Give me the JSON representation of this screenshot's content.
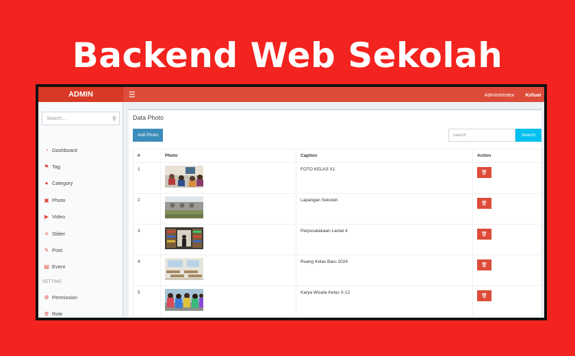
{
  "headline": "Backend Web Sekolah",
  "colors": {
    "background": "#f3231f",
    "header": "#dd4b39",
    "primary": "#3c8dbc",
    "info": "#00c0ef",
    "danger": "#dd4b39"
  },
  "topbar": {
    "brand": "ADMIN",
    "menu_icon": "hamburger-icon",
    "user": "Administrator",
    "logout": "Keluar"
  },
  "sidebar": {
    "search_placeholder": "Search...",
    "items": [
      {
        "label": "Dashboard",
        "icon": "dashboard-icon"
      },
      {
        "label": "Tag",
        "icon": "tag-icon"
      },
      {
        "label": "Category",
        "icon": "circle-icon"
      },
      {
        "label": "Photo",
        "icon": "photo-icon"
      },
      {
        "label": "Video",
        "icon": "video-icon"
      },
      {
        "label": "Slider",
        "icon": "sliders-icon"
      },
      {
        "label": "Post",
        "icon": "edit-icon"
      },
      {
        "label": "Event",
        "icon": "calendar-icon"
      }
    ],
    "section_label": "SETTING",
    "settings_items": [
      {
        "label": "Permission",
        "icon": "gears-icon"
      },
      {
        "label": "Role",
        "icon": "gears-icon"
      }
    ]
  },
  "main": {
    "title": "Data Photo",
    "add_button": "Add Photo",
    "search_placeholder": "seacrh",
    "search_button": "Search",
    "columns": [
      "#",
      "Photo",
      "Caption",
      "Action"
    ],
    "rows": [
      {
        "num": "1",
        "caption": "FOTO KELAS X1",
        "thumb": "classroom-photo"
      },
      {
        "num": "2",
        "caption": "Lapangan Sekolah",
        "thumb": "school-field-photo"
      },
      {
        "num": "3",
        "caption": "Perpusatakaan Lantai 4",
        "thumb": "library-photo"
      },
      {
        "num": "4",
        "caption": "Ruang Kelas Baru 2024",
        "thumb": "new-classroom-photo"
      },
      {
        "num": "5",
        "caption": "Karya Wisata Kelas X-12",
        "thumb": "field-trip-photo"
      }
    ],
    "delete_icon": "trash-icon"
  }
}
